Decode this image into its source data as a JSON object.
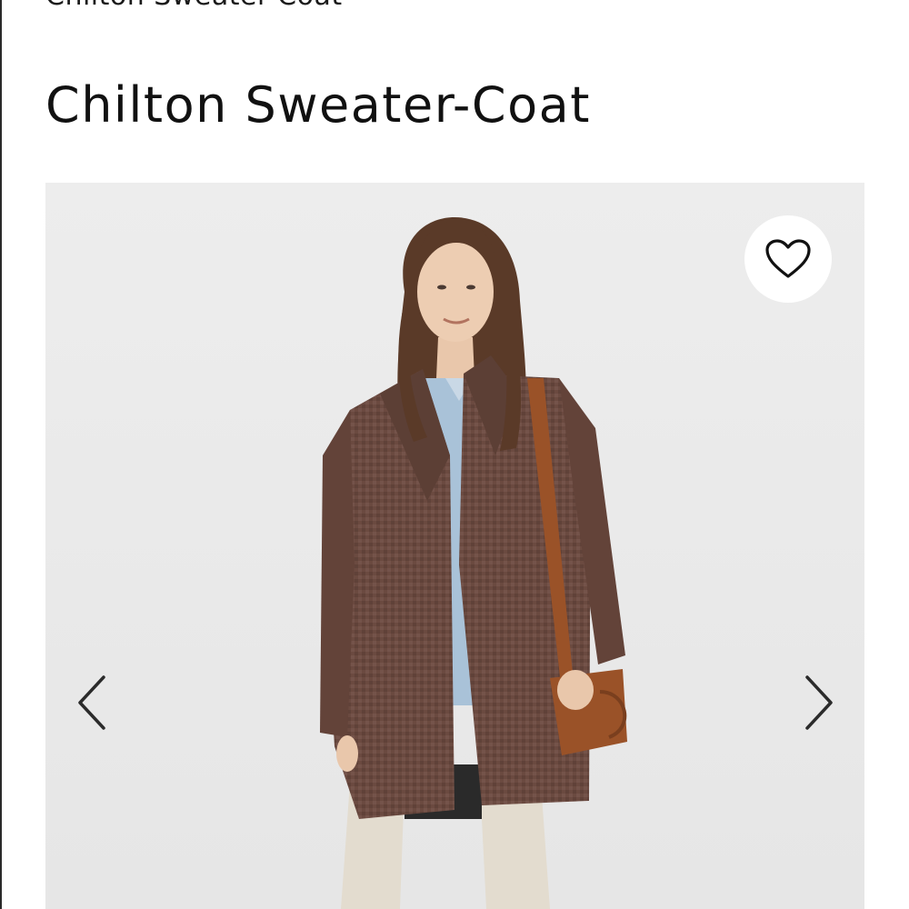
{
  "header": {
    "breadcrumb_title": "Chilton Sweater-Coat"
  },
  "product": {
    "title": "Chilton Sweater-Coat"
  },
  "gallery": {
    "wishlist_icon": "heart-outline-icon",
    "prev_icon": "chevron-left-icon",
    "next_icon": "chevron-right-icon"
  },
  "colors": {
    "background": "#ffffff",
    "gallery_bg": "#ececec",
    "text": "#111111",
    "coat": "#6b4a40",
    "shirt": "#a9c2d8",
    "bag": "#9a5228"
  }
}
